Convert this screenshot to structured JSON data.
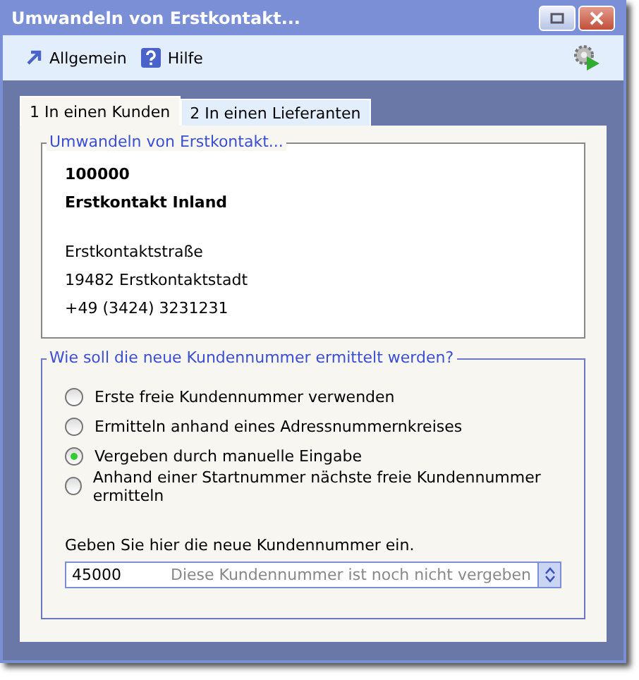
{
  "window": {
    "title": "Umwandeln von Erstkontakt..."
  },
  "toolbar": [
    {
      "kind": "arrow",
      "label": "Allgemein"
    },
    {
      "kind": "help",
      "label": "Hilfe"
    }
  ],
  "tabs": [
    {
      "label": "1 In einen Kunden",
      "selected": true
    },
    {
      "label": "2 In einen Lieferanten",
      "selected": false
    }
  ],
  "contact": {
    "legend": "Umwandeln von Erstkontakt...",
    "number": "100000",
    "name": "Erstkontakt Inland",
    "street": "Erstkontaktstraße",
    "city": "19482 Erstkontaktstadt",
    "phone": "+49 (3424) 3231231"
  },
  "method": {
    "legend": "Wie soll die neue Kundennummer ermittelt werden?",
    "options": [
      {
        "label": "Erste freie Kundennummer verwenden",
        "selected": false
      },
      {
        "label": "Ermitteln anhand eines Adressnummernkreises",
        "selected": false
      },
      {
        "label": "Vergeben durch manuelle Eingabe",
        "selected": true
      },
      {
        "label": "Anhand einer Startnummer nächste freie Kundennummer ermitteln",
        "selected": false
      }
    ],
    "prompt": "Geben Sie hier die neue Kundennummer ein.",
    "value": "45000",
    "status": "Diese Kundennummer ist noch nicht vergeben"
  }
}
